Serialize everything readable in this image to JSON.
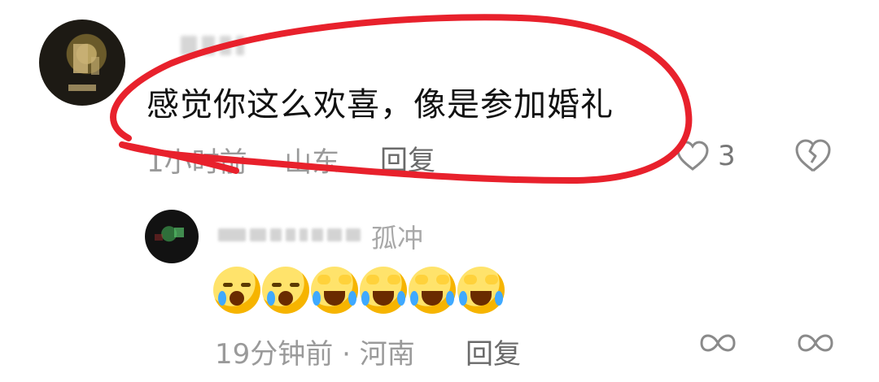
{
  "comment": {
    "text": "感觉你这么欢喜，像是参加婚礼",
    "time": "1小时前",
    "location": "山东",
    "reply_label": "回复",
    "like_count": "3"
  },
  "reply": {
    "name_suffix": "孤冲",
    "emoji_count": 6,
    "time": "19分钟前",
    "location": "河南",
    "reply_label": "回复"
  },
  "icons": {
    "like": "heart-outline-icon",
    "dislike": "broken-heart-icon",
    "reply_like": "infinity-like-icon",
    "reply_dislike": "infinity-dislike-icon"
  },
  "colors": {
    "annotation": "#e8212c",
    "meta": "#9a9a9a"
  }
}
